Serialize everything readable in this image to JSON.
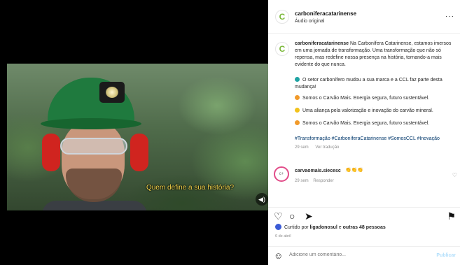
{
  "video": {
    "subtitle": "Quem define a sua história?",
    "sound_icon": "volume-icon"
  },
  "post": {
    "username": "carboniferacatarinense",
    "audio_label": "Áudio original",
    "more": "···"
  },
  "caption": {
    "username": "carboniferacatarinense",
    "text": "Na Carbonífera Catarinense, estamos imersos em uma jornada de transformação. Uma transformação que não só repensa, mas redefine nossa presença na história, tornando-a mais evidente do que nunca.",
    "lines": [
      {
        "text": "O setor carbonífero mudou a sua marca e a CCL faz parte desta mudança!",
        "dot": "#1fa3a3"
      },
      {
        "text": "Somos o Carvão Mais. Energia segura, futuro sustentável.",
        "dot": "#f19a2b"
      },
      {
        "text": "Uma aliança pela valorização e inovação do carvão mineral.",
        "dot": "#f2c21b"
      },
      {
        "text": "Somos o Carvão Mais. Energia segura, futuro sustentável.",
        "dot": "#f19a2b"
      }
    ],
    "hashtags": "#Transformação #CarboníferaCatarinense #SomosCCL #Inovação",
    "time": "29 sem",
    "translate": "Ver tradução"
  },
  "comment": {
    "username": "carvaomais.siecesc",
    "emoji": "👏👏👏",
    "time": "29 sem",
    "reply": "Responder",
    "avatar_text": "c+"
  },
  "actions": {
    "like_icon": "heart-icon",
    "comment_icon": "comment-icon",
    "share_icon": "send-icon",
    "save_icon": "bookmark-icon"
  },
  "likes": {
    "prefix": "Curtido por",
    "user": "ligadonosul",
    "middle": "e",
    "others": "outras 48 pessoas"
  },
  "date": "6 de abril",
  "add_comment": {
    "placeholder": "Adicione um comentário...",
    "publish": "Publicar"
  },
  "colors": {
    "accent": "#7bb83a",
    "link": "#00376b",
    "publish_disabled": "#b2dffc"
  }
}
